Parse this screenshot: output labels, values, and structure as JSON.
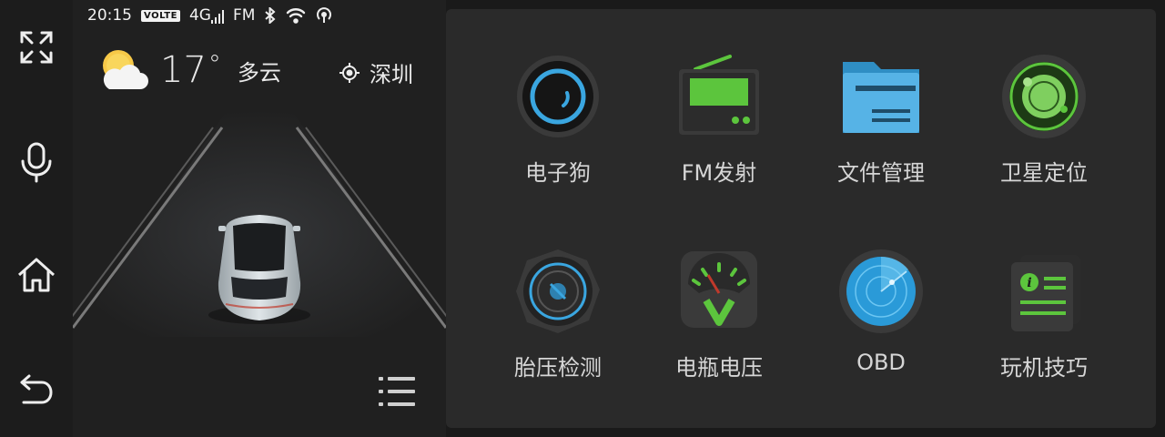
{
  "status_bar": {
    "time": "20:15",
    "volte": "VOLTE",
    "network": "4G",
    "fm": "FM",
    "icons": [
      "bluetooth-icon",
      "wifi-icon",
      "hotspot-icon"
    ]
  },
  "rail": {
    "buttons": [
      "fullscreen-icon",
      "microphone-icon",
      "home-icon",
      "back-icon"
    ]
  },
  "weather": {
    "icon": "partly-cloudy-icon",
    "temperature": "17",
    "degree": "°",
    "condition": "多云"
  },
  "location": {
    "icon": "locate-icon",
    "city": "深圳"
  },
  "menu": {
    "icon": "list-menu-icon"
  },
  "apps": [
    {
      "label": "电子狗",
      "icon": "speed-camera-icon"
    },
    {
      "label": "FM发射",
      "icon": "fm-radio-icon"
    },
    {
      "label": "文件管理",
      "icon": "folder-icon"
    },
    {
      "label": "卫星定位",
      "icon": "gps-icon"
    },
    {
      "label": "胎压检测",
      "icon": "tire-pressure-icon"
    },
    {
      "label": "电瓶电压",
      "icon": "voltmeter-icon"
    },
    {
      "label": "OBD",
      "icon": "radar-icon"
    },
    {
      "label": "玩机技巧",
      "icon": "tips-icon"
    }
  ],
  "colors": {
    "accent_green": "#5cc53d",
    "accent_blue": "#3aa6e0",
    "panel_bg": "#2a2a2a",
    "background": "#1a1a1a"
  }
}
